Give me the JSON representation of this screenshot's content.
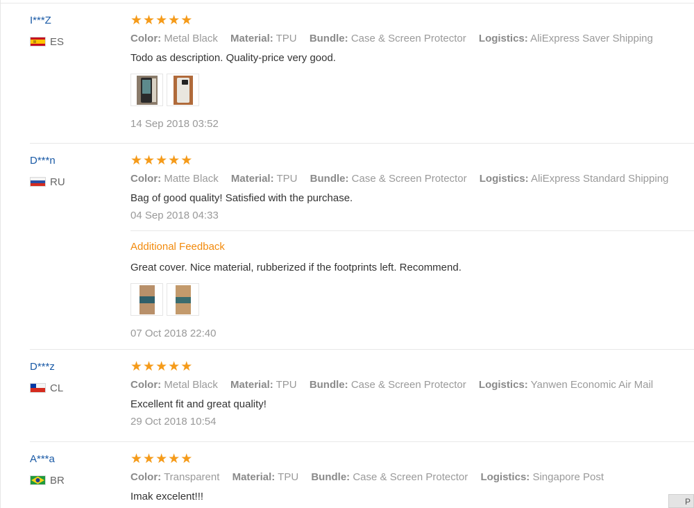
{
  "reviews": [
    {
      "user": "I***Z",
      "country": "ES",
      "flag": "es-flag-icon",
      "stars": 5,
      "attrs": [
        {
          "key": "Color:",
          "val": "Metal Black"
        },
        {
          "key": "Material:",
          "val": "TPU"
        },
        {
          "key": "Bundle:",
          "val": "Case & Screen Protector"
        },
        {
          "key": "Logistics:",
          "val": "AliExpress Saver Shipping"
        }
      ],
      "text": "Todo as description. Quality-price very good.",
      "photos": 2,
      "date": "14 Sep 2018 03:52"
    },
    {
      "user": "D***n",
      "country": "RU",
      "flag": "ru-flag-icon",
      "stars": 5,
      "attrs": [
        {
          "key": "Color:",
          "val": "Matte Black"
        },
        {
          "key": "Material:",
          "val": "TPU"
        },
        {
          "key": "Bundle:",
          "val": "Case & Screen Protector"
        },
        {
          "key": "Logistics:",
          "val": "AliExpress Standard Shipping"
        }
      ],
      "text": "Bag of good quality! Satisfied with the purchase.",
      "date": "04 Sep 2018 04:33",
      "additional": {
        "title": "Additional Feedback",
        "text": "Great cover. Nice material, rubberized if the footprints left. Recommend.",
        "photos": 2,
        "date": "07 Oct 2018 22:40"
      }
    },
    {
      "user": "D***z",
      "country": "CL",
      "flag": "cl-flag-icon",
      "stars": 5,
      "attrs": [
        {
          "key": "Color:",
          "val": "Metal Black"
        },
        {
          "key": "Material:",
          "val": "TPU"
        },
        {
          "key": "Bundle:",
          "val": "Case & Screen Protector"
        },
        {
          "key": "Logistics:",
          "val": "Yanwen Economic Air Mail"
        }
      ],
      "text": "Excellent fit and great quality!",
      "date": "29 Oct 2018 10:54"
    },
    {
      "user": "A***a",
      "country": "BR",
      "flag": "br-flag-icon",
      "stars": 5,
      "attrs": [
        {
          "key": "Color:",
          "val": "Transparent"
        },
        {
          "key": "Material:",
          "val": "TPU"
        },
        {
          "key": "Bundle:",
          "val": "Case & Screen Protector"
        },
        {
          "key": "Logistics:",
          "val": "Singapore Post"
        }
      ],
      "text": "Imak excelent!!!"
    }
  ],
  "scroll_button_label": "P",
  "colors": {
    "star": "#f59b1a",
    "user_link": "#1a5aa6",
    "additional_title": "#f28a0c"
  }
}
